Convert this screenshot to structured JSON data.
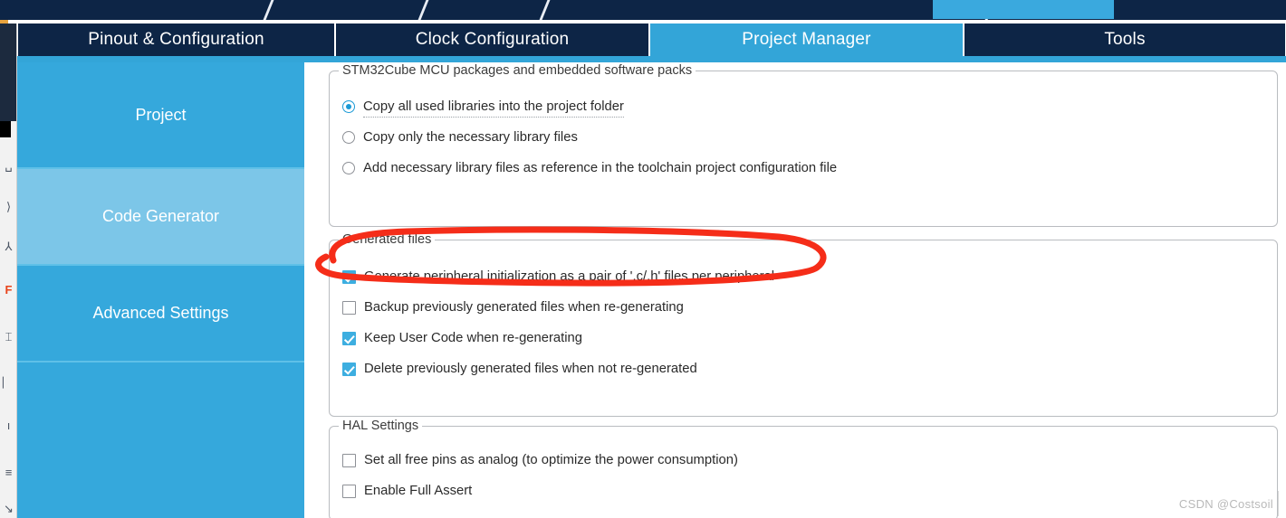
{
  "app": {
    "watermark": "CSDN @Costsoil"
  },
  "tabs": [
    {
      "label": "Pinout & Configuration",
      "active": false
    },
    {
      "label": "Clock Configuration",
      "active": false
    },
    {
      "label": "Project Manager",
      "active": true
    },
    {
      "label": "Tools",
      "active": false
    }
  ],
  "sidebar": {
    "items": [
      {
        "label": "Project",
        "selected": false
      },
      {
        "label": "Code Generator",
        "selected": true
      },
      {
        "label": "Advanced Settings",
        "selected": false
      },
      {
        "label": "",
        "selected": false
      }
    ]
  },
  "groups": {
    "mcu_packages": {
      "title": "STM32Cube MCU packages and embedded software packs",
      "options": [
        {
          "label": "Copy all used libraries into the project folder",
          "checked": true,
          "focused": true
        },
        {
          "label": "Copy only the necessary library files",
          "checked": false,
          "focused": false
        },
        {
          "label": "Add necessary library files as reference in the toolchain project configuration file",
          "checked": false,
          "focused": false
        }
      ]
    },
    "generated_files": {
      "title": "Generated files",
      "options": [
        {
          "label": "Generate peripheral initialization as a pair of '.c/.h' files per peripheral",
          "checked": true
        },
        {
          "label": "Backup previously generated files when re-generating",
          "checked": false
        },
        {
          "label": "Keep User Code when re-generating",
          "checked": true
        },
        {
          "label": "Delete previously generated files when not re-generated",
          "checked": true
        }
      ]
    },
    "hal_settings": {
      "title": "HAL Settings",
      "options": [
        {
          "label": "Set all free pins as analog (to optimize the power consumption)",
          "checked": false
        },
        {
          "label": "Enable Full Assert",
          "checked": false
        }
      ]
    }
  },
  "left_strip": {
    "glyphs": [
      "␣",
      "⟩",
      "⅄",
      "F",
      "⌶",
      "⎸",
      "ı",
      "≡",
      "↘"
    ]
  },
  "colors": {
    "tab_active": "#33a5d8",
    "tab_inactive": "#0d2546",
    "sidebar": "#35a8dc",
    "sidebar_selected": "#7cc6e8",
    "checkbox_on": "#3daee0",
    "radio_on": "#1b9ad6",
    "annotation": "#f52d19"
  }
}
